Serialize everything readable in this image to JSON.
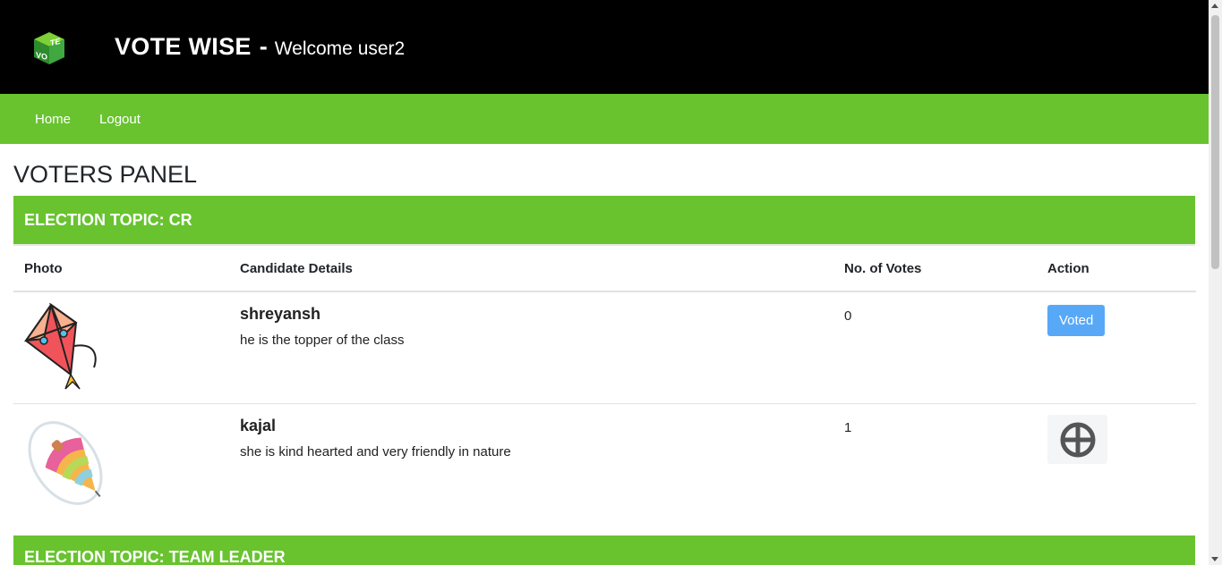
{
  "header": {
    "brand": "VOTE WISE",
    "separator": "-",
    "welcome": "Welcome user2",
    "logo_icon": "vote-cube-icon"
  },
  "nav": {
    "items": [
      {
        "label": "Home"
      },
      {
        "label": "Logout"
      }
    ]
  },
  "panel_title": "VOTERS PANEL",
  "elections": [
    {
      "topic": "ELECTION TOPIC: CR",
      "columns": [
        "Photo",
        "Candidate Details",
        "No. of Votes",
        "Action"
      ],
      "candidates": [
        {
          "photo_icon": "kite-icon",
          "name": "shreyansh",
          "description": "he is the topper of the class",
          "votes": "0",
          "action_label": "Voted"
        },
        {
          "photo_icon": "spinning-top-icon",
          "name": "kajal",
          "description": "she is kind hearted and very friendly in nature",
          "votes": "1",
          "action_icon": "party-symbol-icon"
        }
      ]
    },
    {
      "topic": "ELECTION TOPIC: TEAM LEADER"
    }
  ],
  "colors": {
    "header_bg": "#000000",
    "nav_bg": "#68c32f",
    "voted_button": "#58a8f8"
  }
}
